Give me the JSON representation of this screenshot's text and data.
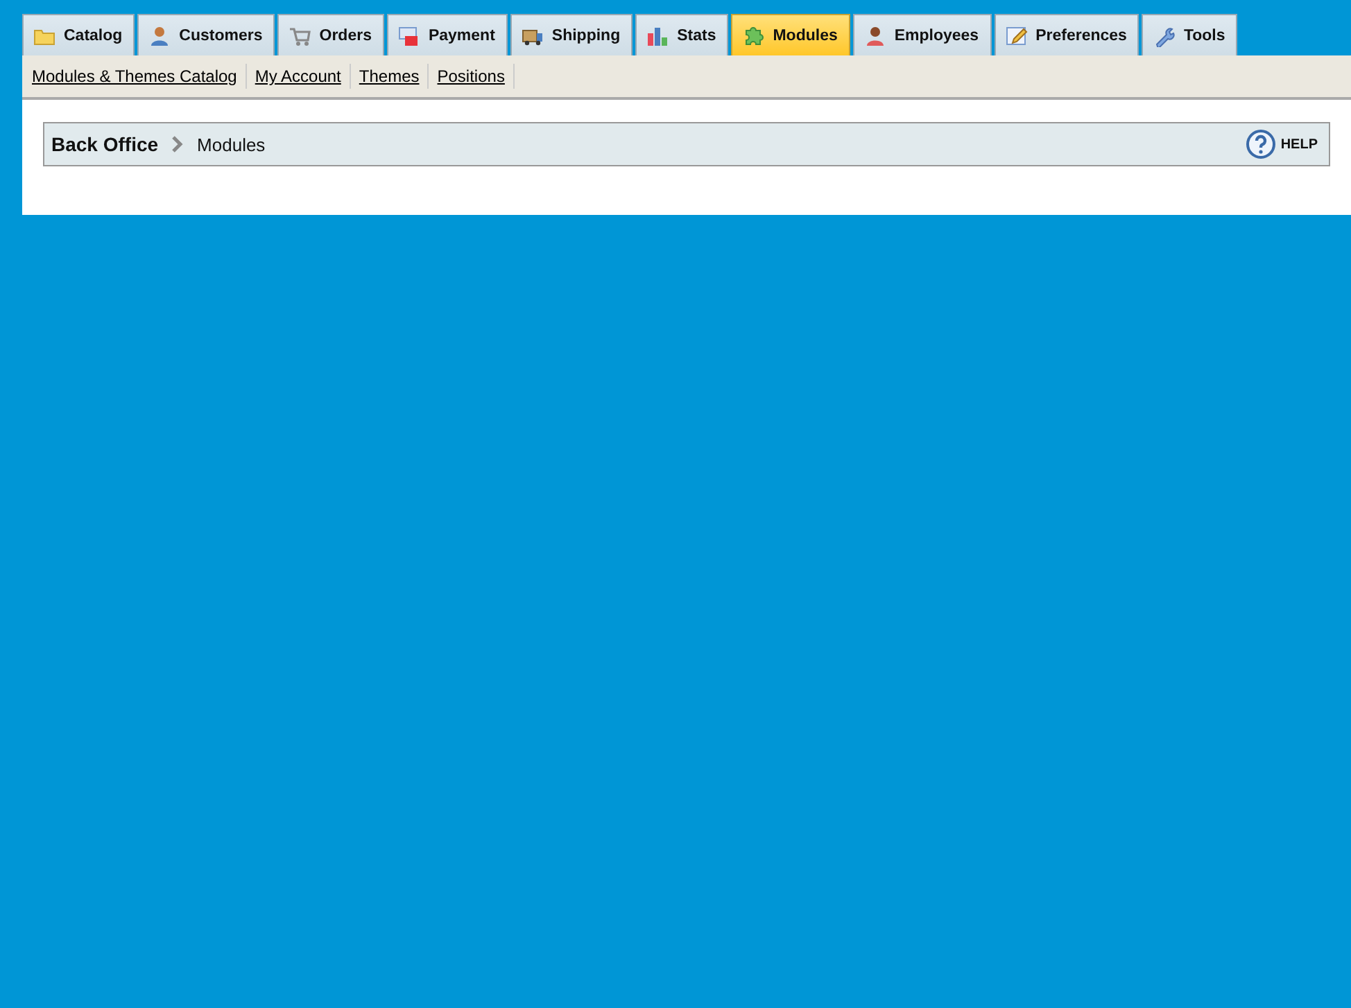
{
  "tabs": [
    {
      "label": "Catalog",
      "selected": false
    },
    {
      "label": "Customers",
      "selected": false
    },
    {
      "label": "Orders",
      "selected": false
    },
    {
      "label": "Payment",
      "selected": false
    },
    {
      "label": "Shipping",
      "selected": false
    },
    {
      "label": "Stats",
      "selected": false
    },
    {
      "label": "Modules",
      "selected": true
    },
    {
      "label": "Employees",
      "selected": false
    },
    {
      "label": "Preferences",
      "selected": false
    },
    {
      "label": "Tools",
      "selected": false
    }
  ],
  "subnav": [
    "Modules & Themes Catalog",
    "My Account",
    "Themes",
    "Positions"
  ],
  "breadcrumb": {
    "root": "Back Office",
    "current": "Modules"
  },
  "help": "HELP"
}
